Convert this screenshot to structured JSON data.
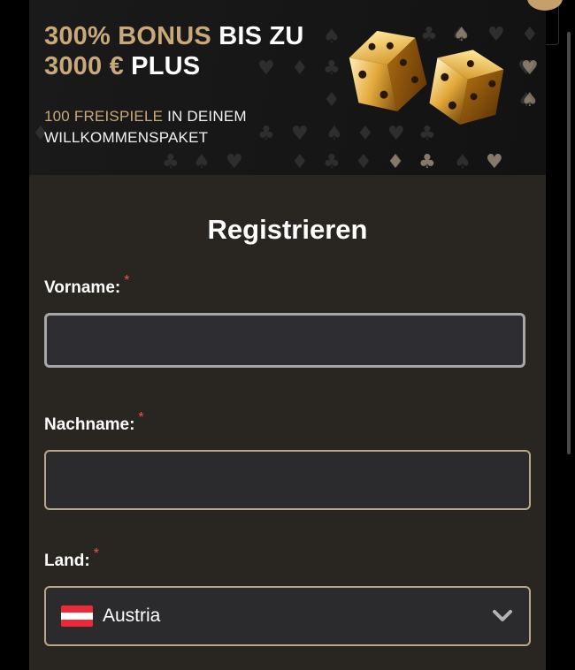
{
  "promo": {
    "title_gold_1": "300% BONUS",
    "title_white_1": "BIS ZU",
    "title_gold_2": "3000 €",
    "title_white_2": "PLUS",
    "sub_gold": "100 FREISPIELE",
    "sub_white_1": "IN DEINEM",
    "sub_white_2": "WILLKOMMENSPAKET"
  },
  "form": {
    "title": "Registrieren",
    "required_mark": "*",
    "first_name_label": "Vorname:",
    "first_name_value": "",
    "last_name_label": "Nachname:",
    "last_name_value": "",
    "country_label": "Land:",
    "country_value": "Austria",
    "country_flag": "austria-flag"
  },
  "colors": {
    "accent_gold": "#c9a97a",
    "modal_background": "#292621",
    "field_border": "#b9a78a",
    "focused_border": "#a7a7a7",
    "required": "#e05a4a"
  }
}
